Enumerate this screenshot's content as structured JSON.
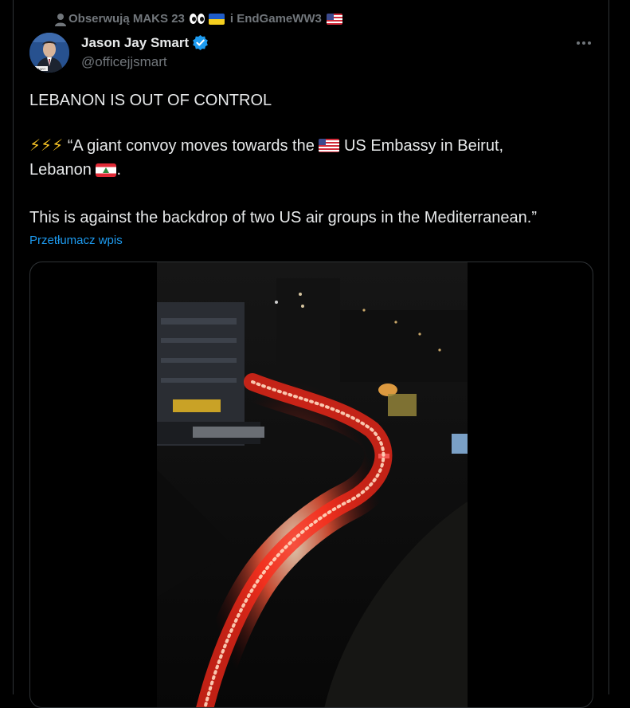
{
  "social_context": {
    "prefix": "Obserwują MAKS 23",
    "connector": "i EndGameWW3",
    "person_icon": "person-icon",
    "emojis": [
      "eyes-emoji",
      "ukraine-flag-emoji",
      "us-flag-emoji"
    ]
  },
  "author": {
    "name": "Jason Jay Smart",
    "handle": "@officejjsmart",
    "verified_icon": "verified-badge-icon",
    "avatar_caption": "MART"
  },
  "menu_icon": "more-options-icon",
  "tweet": {
    "line1": "LEBANON IS OUT OF CONTROL",
    "bolts": "⚡⚡⚡",
    "line2_a": "“A giant convoy moves towards the",
    "line2_b": "US Embassy in Beirut,",
    "line3_a": "Lebanon",
    "line3_b": ".",
    "line4": "This is against the backdrop of two US air groups in the Mediterranean.”",
    "flags": [
      "us-flag-emoji",
      "lebanon-flag-emoji"
    ]
  },
  "translate_label": "Przetłumacz wpis",
  "media": {
    "type": "video",
    "description_icon": "video-thumbnail"
  },
  "colors": {
    "background": "#000000",
    "text_primary": "#e7e9ea",
    "text_secondary": "#71767b",
    "link": "#1d9bf0",
    "verified": "#1d9bf0",
    "border": "#2f3336"
  }
}
